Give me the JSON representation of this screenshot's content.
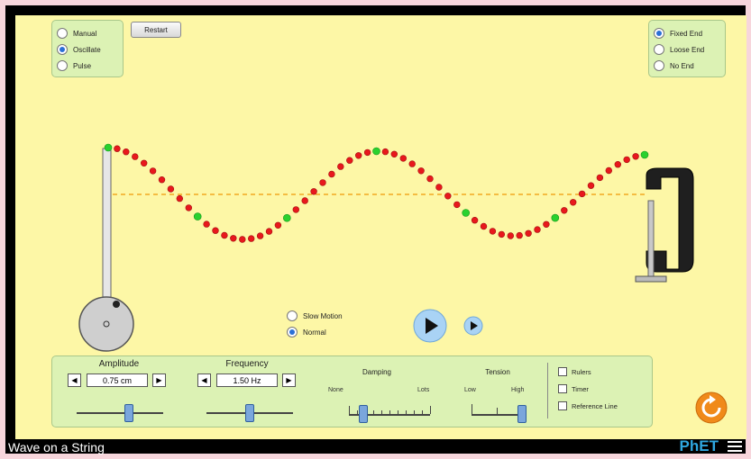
{
  "mode_options": [
    {
      "label": "Manual",
      "selected": false
    },
    {
      "label": "Oscillate",
      "selected": true
    },
    {
      "label": "Pulse",
      "selected": false
    }
  ],
  "restart_label": "Restart",
  "end_options": [
    {
      "label": "Fixed End",
      "selected": true
    },
    {
      "label": "Loose End",
      "selected": false
    },
    {
      "label": "No End",
      "selected": false
    }
  ],
  "speed_options": [
    {
      "label": "Slow Motion",
      "selected": false
    },
    {
      "label": "Normal",
      "selected": true
    }
  ],
  "amplitude": {
    "label": "Amplitude",
    "value": "0.75 cm",
    "slider_fraction": 0.6
  },
  "frequency": {
    "label": "Frequency",
    "value": "1.50 Hz",
    "slider_fraction": 0.5
  },
  "damping": {
    "label": "Damping",
    "min_label": "None",
    "max_label": "Lots",
    "slider_fraction": 0.18
  },
  "tension": {
    "label": "Tension",
    "min_label": "Low",
    "max_label": "High",
    "slider_fraction": 1.0
  },
  "checkboxes": [
    {
      "label": "Rulers",
      "checked": false
    },
    {
      "label": "Timer",
      "checked": false
    },
    {
      "label": "Reference Line",
      "checked": false
    }
  ],
  "app_title": "Wave on a String",
  "brand": {
    "ph": "PhET"
  },
  "colors": {
    "bead": "#e8181c",
    "bead_marker": "#29d12e",
    "reference_line": "#f2a820",
    "stage": "#fdf7a6",
    "panel": "#dcf2b4",
    "reset": "#f08a1a"
  }
}
